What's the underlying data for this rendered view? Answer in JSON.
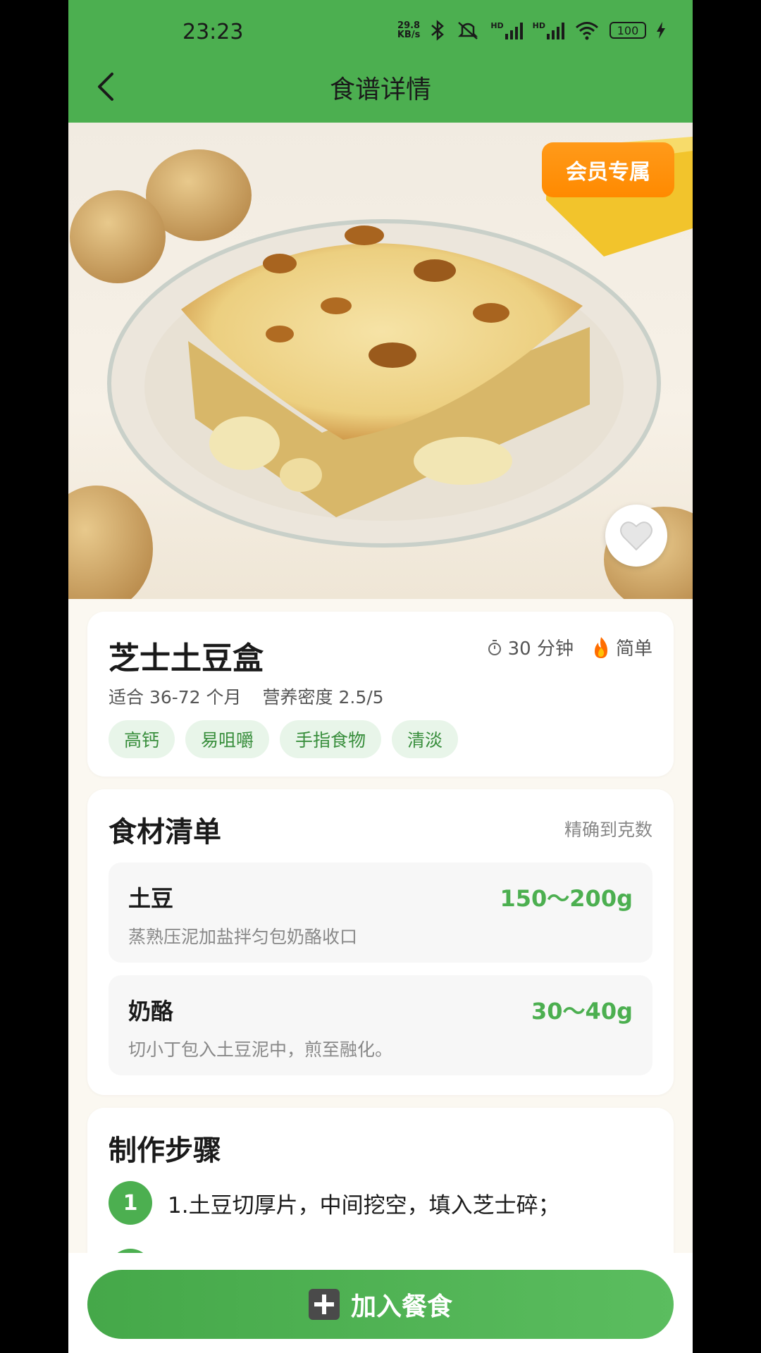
{
  "status_bar": {
    "time": "23:23",
    "net_speed_value": "29.8",
    "net_speed_unit": "KB/s",
    "network_1": "HD",
    "network_2": "HD",
    "battery": "100"
  },
  "header": {
    "title": "食谱详情"
  },
  "hero": {
    "badge": "会员专属"
  },
  "recipe": {
    "name": "芝士土豆盒",
    "time": "30 分钟",
    "difficulty": "简单",
    "age_range": "适合 36-72 个月",
    "nutrition": "营养密度 2.5/5",
    "tags": [
      "高钙",
      "易咀嚼",
      "手指食物",
      "清淡"
    ]
  },
  "ingredients": {
    "title": "食材清单",
    "note": "精确到克数",
    "items": [
      {
        "name": "土豆",
        "amount": "150～200g",
        "desc": "蒸熟压泥加盐拌匀包奶酪收口"
      },
      {
        "name": "奶酪",
        "amount": "30～40g",
        "desc": "切小丁包入土豆泥中，煎至融化。"
      }
    ]
  },
  "steps": {
    "title": "制作步骤",
    "items": [
      {
        "num": "1",
        "text": "1.土豆切厚片，中间挖空，填入芝士碎；"
      }
    ]
  },
  "bottom": {
    "add_label": "加入餐食"
  },
  "colors": {
    "primary": "#4caf50",
    "badge": "#ff8a00"
  }
}
